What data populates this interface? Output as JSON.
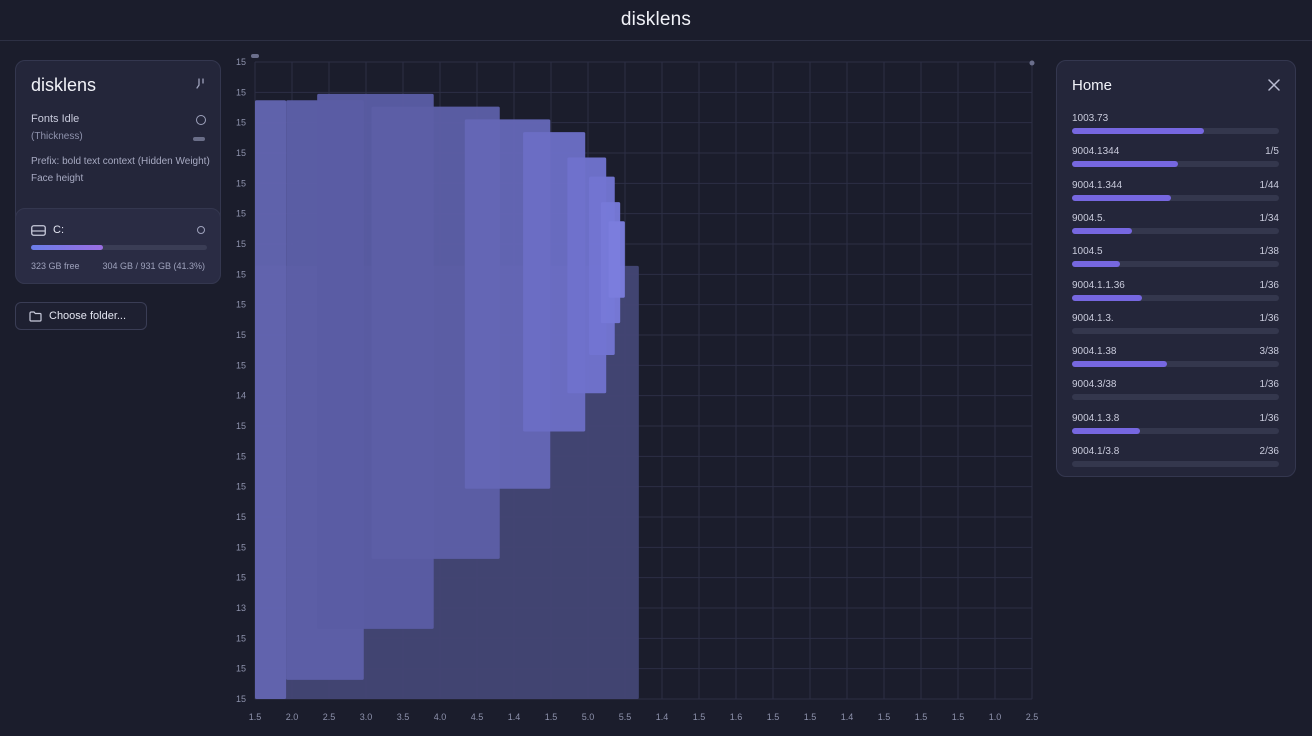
{
  "window": {
    "title": "disklens"
  },
  "sidebar": {
    "brand": "disklens",
    "row1": "Fonts Idle",
    "row2": "(Thickness)",
    "row3": "Prefix: bold text context (Hidden Weight) Face height",
    "drive": {
      "label": "C:",
      "free_text": "323 GB free",
      "used_text": "304 GB / 931 GB (41.3%)",
      "used_fraction": 0.41
    },
    "choose_button": "Choose folder..."
  },
  "chart_data": {
    "type": "area",
    "description_free": true,
    "x_tick_labels": [
      "1.5",
      "2.0",
      "2.5",
      "3.0",
      "3.5",
      "4.0",
      "4.5",
      "1.4",
      "1.5",
      "5.0",
      "5.5",
      "1.4",
      "1.5",
      "1.6",
      "1.5",
      "1.5",
      "1.4",
      "1.5",
      "1.5",
      "1.5",
      "1.0",
      "2.5"
    ],
    "y_tick_labels": [
      "15",
      "15",
      "15",
      "15",
      "15",
      "15",
      "15",
      "15",
      "15",
      "15",
      "15",
      "14",
      "15",
      "15",
      "15",
      "15",
      "15",
      "15",
      "13",
      "15",
      "15",
      "15"
    ],
    "blocks": [
      {
        "x0": 0.0,
        "x1": 0.494,
        "y0": 0.0,
        "y1": 0.68,
        "color": "#434574"
      },
      {
        "x0": 0.0,
        "x1": 0.04,
        "y0": 0.0,
        "y1": 0.94,
        "color": "#6264b0"
      },
      {
        "x0": 0.04,
        "x1": 0.14,
        "y0": 0.03,
        "y1": 0.94,
        "color": "#5d5fa8"
      },
      {
        "x0": 0.08,
        "x1": 0.23,
        "y0": 0.11,
        "y1": 0.95,
        "color": "#5a5ca4"
      },
      {
        "x0": 0.15,
        "x1": 0.315,
        "y0": 0.22,
        "y1": 0.93,
        "color": "#5c5ea6"
      },
      {
        "x0": 0.27,
        "x1": 0.38,
        "y0": 0.33,
        "y1": 0.91,
        "color": "#6466b6"
      },
      {
        "x0": 0.345,
        "x1": 0.425,
        "y0": 0.42,
        "y1": 0.89,
        "color": "#6b6dc4"
      },
      {
        "x0": 0.402,
        "x1": 0.452,
        "y0": 0.48,
        "y1": 0.85,
        "color": "#7072cc"
      },
      {
        "x0": 0.43,
        "x1": 0.463,
        "y0": 0.54,
        "y1": 0.82,
        "color": "#7375d2"
      },
      {
        "x0": 0.445,
        "x1": 0.47,
        "y0": 0.59,
        "y1": 0.78,
        "color": "#7779d8"
      },
      {
        "x0": 0.455,
        "x1": 0.476,
        "y0": 0.63,
        "y1": 0.75,
        "color": "#7b7ddd"
      }
    ]
  },
  "details": {
    "title": "Home",
    "items": [
      {
        "name": "1003.73",
        "value": "",
        "fraction": 0.64
      },
      {
        "name": "9004.1344",
        "value": "1/5",
        "fraction": 0.51
      },
      {
        "name": "9004.1.344",
        "value": "1/44",
        "fraction": 0.48
      },
      {
        "name": "9004.5.",
        "value": "1/34",
        "fraction": 0.29
      },
      {
        "name": "1004.5",
        "value": "1/38",
        "fraction": 0.23
      },
      {
        "name": "9004.1.1.36",
        "value": "1/36",
        "fraction": 0.34
      },
      {
        "name": "9004.1.3.",
        "value": "1/36",
        "fraction": 0.0
      },
      {
        "name": "9004.1.38",
        "value": "3/38",
        "fraction": 0.46
      },
      {
        "name": "9004.3/38",
        "value": "1/36",
        "fraction": 0.0
      },
      {
        "name": "9004.1.3.8",
        "value": "1/36",
        "fraction": 0.33
      },
      {
        "name": "9004.1/3.8",
        "value": "2/36",
        "fraction": 0.0
      }
    ]
  }
}
